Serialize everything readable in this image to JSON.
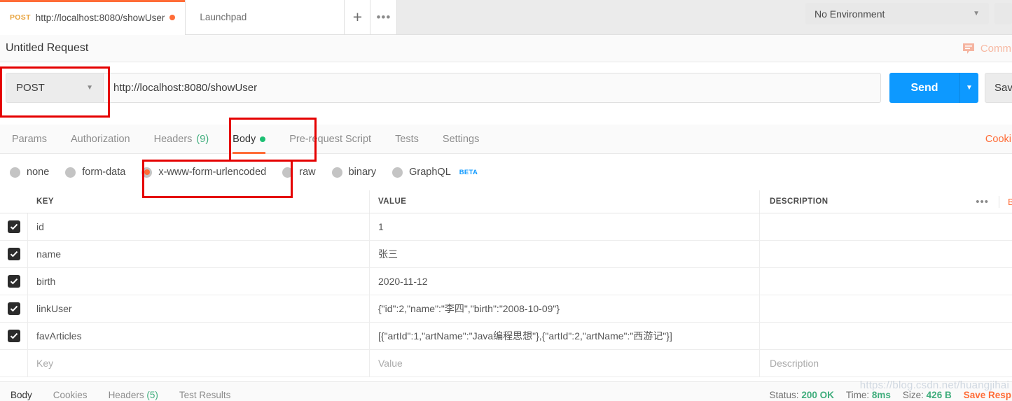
{
  "window": {
    "watermark": "https://blog.csdn.net/huangjihai"
  },
  "tabs": {
    "items": [
      {
        "method": "POST",
        "title": "http://localhost:8080/showUser",
        "unsaved": true,
        "active": true
      },
      {
        "title": "Launchpad",
        "active": false
      }
    ],
    "new_tab_label": "+",
    "more_label": "•••"
  },
  "environment": {
    "selected": "No Environment",
    "caret": "▼"
  },
  "request": {
    "name": "Untitled Request",
    "comments_label": "Comm",
    "method": "POST",
    "method_caret": "▼",
    "url": "http://localhost:8080/showUser",
    "send_label": "Send",
    "send_caret": "▼",
    "save_label": "Sav"
  },
  "request_tabs": {
    "items": [
      {
        "label": "Params",
        "count": "",
        "dot": false,
        "active": false
      },
      {
        "label": "Authorization",
        "count": "",
        "dot": false,
        "active": false
      },
      {
        "label": "Headers",
        "count": "(9)",
        "dot": false,
        "active": false
      },
      {
        "label": "Body",
        "count": "",
        "dot": true,
        "active": true
      },
      {
        "label": "Pre-request Script",
        "count": "",
        "dot": false,
        "active": false
      },
      {
        "label": "Tests",
        "count": "",
        "dot": false,
        "active": false
      },
      {
        "label": "Settings",
        "count": "",
        "dot": false,
        "active": false
      }
    ],
    "cookies_label": "Cooki"
  },
  "body_types": {
    "options": [
      {
        "label": "none",
        "selected": false,
        "beta": ""
      },
      {
        "label": "form-data",
        "selected": false,
        "beta": ""
      },
      {
        "label": "x-www-form-urlencoded",
        "selected": true,
        "beta": ""
      },
      {
        "label": "raw",
        "selected": false,
        "beta": ""
      },
      {
        "label": "binary",
        "selected": false,
        "beta": ""
      },
      {
        "label": "GraphQL",
        "selected": false,
        "beta": "BETA"
      }
    ]
  },
  "table": {
    "headers": {
      "key": "KEY",
      "value": "VALUE",
      "description": "DESCRIPTION"
    },
    "header_menu": "•••",
    "bulk_edit_label": "B",
    "rows": [
      {
        "checked": true,
        "key": "id",
        "value": "1",
        "description": ""
      },
      {
        "checked": true,
        "key": "name",
        "value": "张三",
        "description": ""
      },
      {
        "checked": true,
        "key": "birth",
        "value": "2020-11-12",
        "description": ""
      },
      {
        "checked": true,
        "key": "linkUser",
        "value": "{\"id\":2,\"name\":\"李四\",\"birth\":\"2008-10-09\"}",
        "description": ""
      },
      {
        "checked": true,
        "key": "favArticles",
        "value": "[{\"artId\":1,\"artName\":\"Java编程思想\"},{\"artId\":2,\"artName\":\"西游记\"}]",
        "description": ""
      }
    ],
    "placeholder_row": {
      "key": "Key",
      "value": "Value",
      "description": "Description"
    }
  },
  "response": {
    "tabs": [
      {
        "label": "Body",
        "count": "",
        "active": true
      },
      {
        "label": "Cookies",
        "count": "",
        "active": false
      },
      {
        "label": "Headers",
        "count": "(5)",
        "active": false
      },
      {
        "label": "Test Results",
        "count": "",
        "active": false
      }
    ],
    "status_label": "Status:",
    "status_value": "200 OK",
    "time_label": "Time:",
    "time_value": "8ms",
    "size_label": "Size:",
    "size_value": "426 B",
    "save_response_label": "Save Resp"
  },
  "colors": {
    "accent_orange": "#ff6c37",
    "send_blue": "#0d99ff",
    "status_green": "#3fad7c",
    "annotation_red": "#e50000"
  }
}
